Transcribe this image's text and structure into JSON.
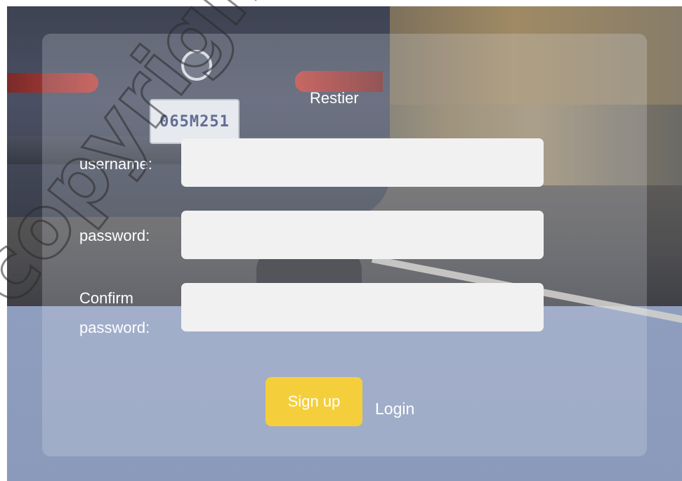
{
  "form": {
    "title": "Restier",
    "username_label": "username:",
    "password_label": "password:",
    "confirm_label_line1": "Confirm",
    "confirm_label_line2": "password:",
    "username_value": "",
    "password_value": "",
    "confirm_value": "",
    "signup_label": "Sign up",
    "login_label": "Login"
  },
  "background": {
    "plate_text": "065M251"
  },
  "watermark": {
    "text": "copyright UXW"
  },
  "colors": {
    "accent": "#f5cf3b",
    "field_bg": "#f1f1f1",
    "label_text": "#ffffff"
  }
}
